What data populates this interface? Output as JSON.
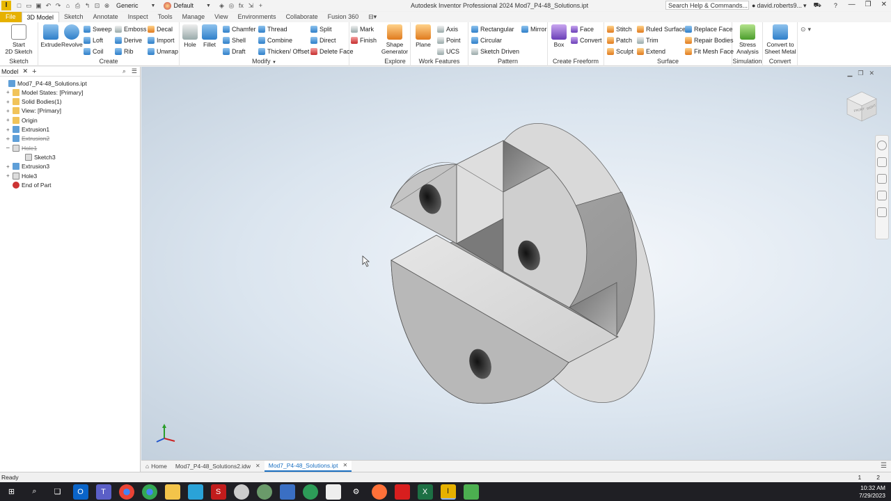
{
  "window": {
    "logo": "I",
    "title": "Autodesk Inventor Professional 2024   Mod7_P4-48_Solutions.ipt",
    "search_placeholder": "Search Help & Commands...",
    "user": "david.roberts9...",
    "appearance": "Generic",
    "material": "Default"
  },
  "ribbon_tabs": [
    "File",
    "3D Model",
    "Sketch",
    "Annotate",
    "Inspect",
    "Tools",
    "Manage",
    "View",
    "Environments",
    "Collaborate",
    "Fusion 360"
  ],
  "groups": {
    "sketch": {
      "label": "Sketch",
      "start": "Start\n2D Sketch"
    },
    "create": {
      "label": "Create",
      "extrude": "Extrude",
      "revolve": "Revolve",
      "sweep": "Sweep",
      "loft": "Loft",
      "coil": "Coil",
      "emboss": "Emboss",
      "derive": "Derive",
      "rib": "Rib",
      "decal": "Decal",
      "import": "Import",
      "unwrap": "Unwrap"
    },
    "modify": {
      "label": "Modify",
      "hole": "Hole",
      "fillet": "Fillet",
      "chamfer": "Chamfer",
      "shell": "Shell",
      "draft": "Draft",
      "thread": "Thread",
      "combine": "Combine",
      "thicken": "Thicken/ Offset",
      "split": "Split",
      "direct": "Direct",
      "delete_face": "Delete Face"
    },
    "explore": {
      "label": "Explore",
      "shape": "Shape\nGenerator",
      "mark": "Mark",
      "finish": "Finish"
    },
    "work": {
      "label": "Work Features",
      "plane": "Plane",
      "axis": "Axis",
      "point": "Point",
      "ucs": "UCS"
    },
    "pattern": {
      "label": "Pattern",
      "rect": "Rectangular",
      "circ": "Circular",
      "sketch_driven": "Sketch Driven",
      "mirror": "Mirror"
    },
    "freeform": {
      "label": "Create Freeform",
      "box": "Box",
      "face": "Face",
      "convert": "Convert"
    },
    "surface": {
      "label": "Surface",
      "stitch": "Stitch",
      "patch": "Patch",
      "sculpt": "Sculpt",
      "ruled": "Ruled Surface",
      "trim": "Trim",
      "extend": "Extend",
      "replace": "Replace Face",
      "repair": "Repair Bodies",
      "fitmesh": "Fit Mesh Face"
    },
    "simulation": {
      "label": "Simulation",
      "stress": "Stress\nAnalysis"
    },
    "convert": {
      "label": "Convert",
      "sheet": "Convert to\nSheet Metal"
    }
  },
  "browser": {
    "tab": "Model",
    "items": [
      {
        "label": "Mod7_P4-48_Solutions.ipt",
        "icon": "part-icon",
        "indent": 0,
        "exp": "",
        "dis": false
      },
      {
        "label": "Model States: [Primary]",
        "icon": "folder-icon",
        "indent": 1,
        "exp": "+",
        "dis": false
      },
      {
        "label": "Solid Bodies(1)",
        "icon": "folder-icon",
        "indent": 1,
        "exp": "+",
        "dis": false
      },
      {
        "label": "View: [Primary]",
        "icon": "view-icon",
        "indent": 1,
        "exp": "+",
        "dis": false
      },
      {
        "label": "Origin",
        "icon": "folder-icon",
        "indent": 1,
        "exp": "+",
        "dis": false
      },
      {
        "label": "Extrusion1",
        "icon": "extrude-icon",
        "indent": 1,
        "exp": "+",
        "dis": false
      },
      {
        "label": "Extrusion2",
        "icon": "extrude-icon",
        "indent": 1,
        "exp": "+",
        "dis": true
      },
      {
        "label": "Hole1",
        "icon": "hole-icon",
        "indent": 1,
        "exp": "−",
        "dis": true
      },
      {
        "label": "Sketch3",
        "icon": "sketch-icon",
        "indent": 2,
        "exp": "",
        "dis": false
      },
      {
        "label": "Extrusion3",
        "icon": "extrude-icon",
        "indent": 1,
        "exp": "+",
        "dis": false
      },
      {
        "label": "Hole3",
        "icon": "hole-icon",
        "indent": 1,
        "exp": "+",
        "dis": false
      },
      {
        "label": "End of Part",
        "icon": "end-icon",
        "indent": 1,
        "exp": "",
        "dis": false
      }
    ]
  },
  "doc_tabs": {
    "home": "Home",
    "tab1": "Mod7_P4-48_Solutions2.idw",
    "tab2": "Mod7_P4-48_Solutions.ipt"
  },
  "status": {
    "text": "Ready",
    "page1": "1",
    "page2": "2"
  },
  "clock": {
    "time": "10:32 AM",
    "date": "7/29/2023"
  },
  "viewcube": {
    "front": "FRONT",
    "right": "RIGHT"
  }
}
